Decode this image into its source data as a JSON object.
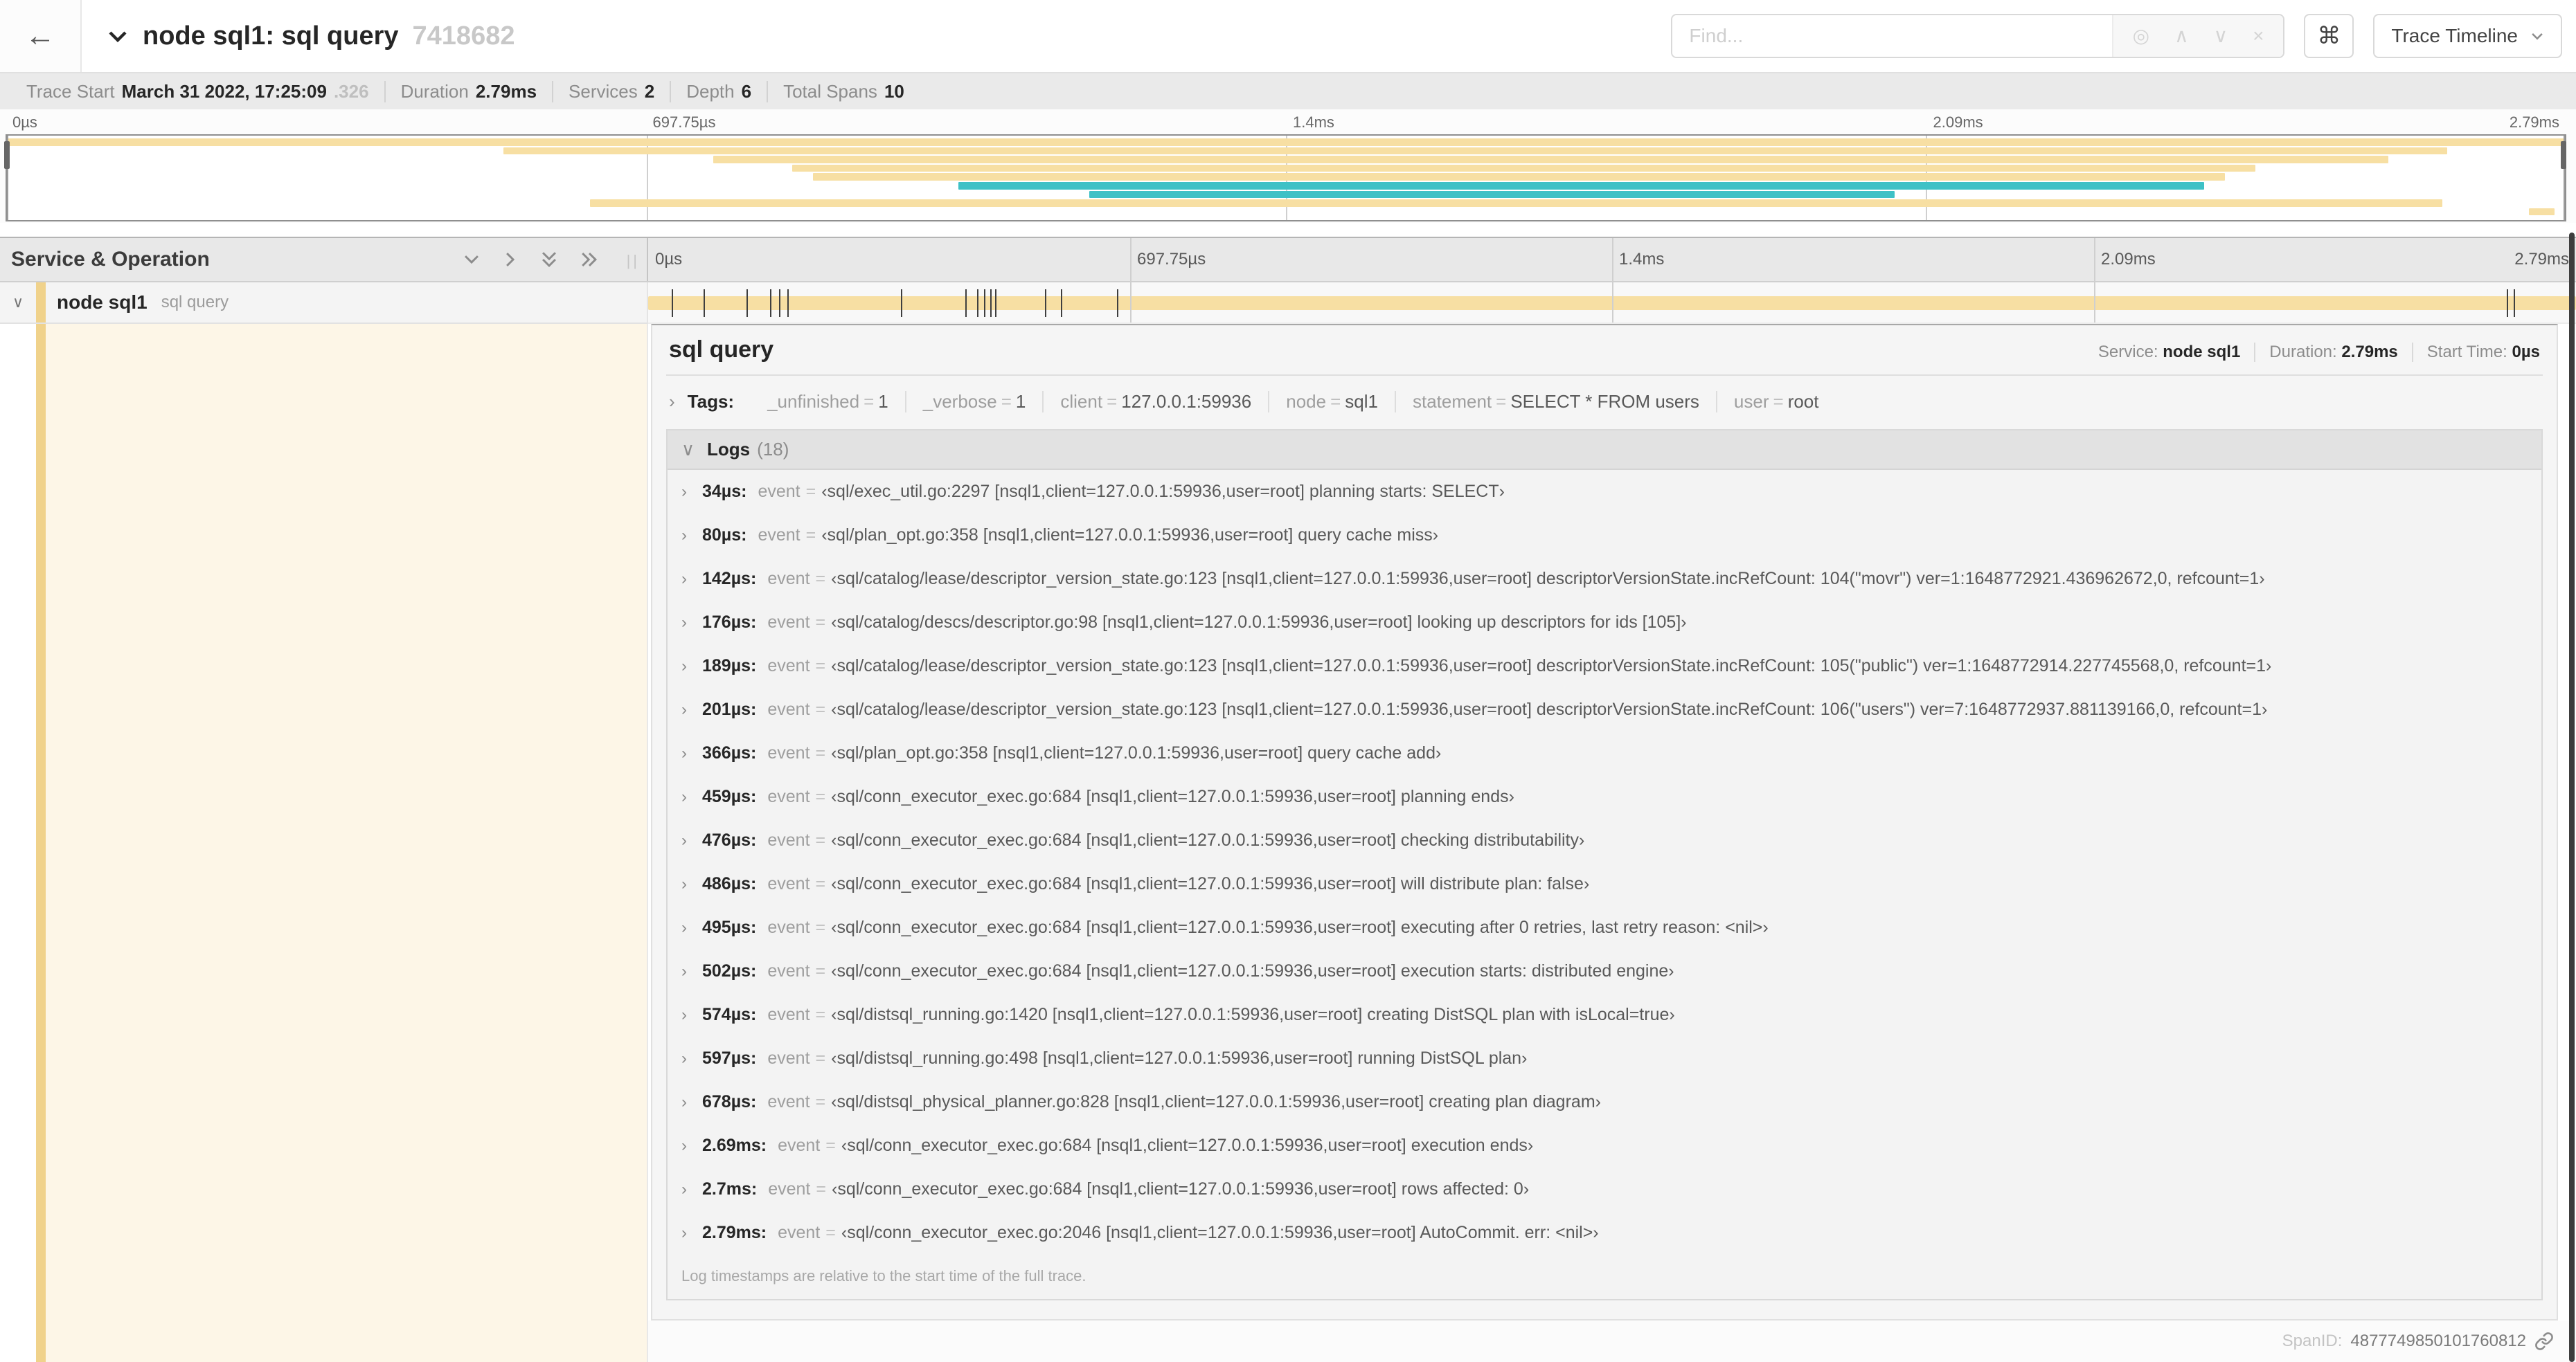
{
  "colors": {
    "tan": "#F7DFA3",
    "teal": "#3EC1C6",
    "strip": "#F0D28B",
    "cream": "#FDF6E7"
  },
  "icons": {
    "back": "←",
    "chevron_down": "∨",
    "chevron_right": "›",
    "focus": "◎",
    "up": "∧",
    "down": "∨",
    "close": "×",
    "command": "⌘",
    "grip": "||"
  },
  "header": {
    "title": "node sql1: sql query",
    "trace_id": "7418682",
    "find_placeholder": "Find...",
    "view_select_label": "Trace Timeline"
  },
  "trace_info": {
    "items": [
      {
        "label": "Trace Start",
        "value": "March 31 2022, 17:25:09",
        "suffix": ".326"
      },
      {
        "label": "Duration",
        "value": "2.79ms"
      },
      {
        "label": "Services",
        "value": "2"
      },
      {
        "label": "Depth",
        "value": "6"
      },
      {
        "label": "Total Spans",
        "value": "10"
      }
    ]
  },
  "minimap": {
    "ticks": [
      "0µs",
      "697.75µs",
      "1.4ms",
      "2.09ms",
      "2.79ms"
    ],
    "spans": [
      {
        "start": 0.0,
        "end": 1.0,
        "color": "tan"
      },
      {
        "start": 0.194,
        "end": 0.954,
        "color": "tan"
      },
      {
        "start": 0.276,
        "end": 0.931,
        "color": "tan"
      },
      {
        "start": 0.307,
        "end": 0.879,
        "color": "tan"
      },
      {
        "start": 0.315,
        "end": 0.867,
        "color": "tan"
      },
      {
        "start": 0.372,
        "end": 0.859,
        "color": "teal"
      },
      {
        "start": 0.423,
        "end": 0.738,
        "color": "teal"
      },
      {
        "start": 0.228,
        "end": 0.952,
        "color": "tan"
      },
      {
        "start": 0.986,
        "end": 0.996,
        "color": "tan"
      }
    ]
  },
  "timeline": {
    "column_header": "Service & Operation",
    "ticks": [
      "0µs",
      "697.75µs",
      "1.4ms",
      "2.09ms",
      "2.79ms"
    ]
  },
  "span_row": {
    "service": "node sql1",
    "operation": "sql query",
    "duration_us": 2790,
    "log_marker_times_us": [
      34,
      80,
      142,
      176,
      189,
      201,
      366,
      459,
      476,
      486,
      495,
      502,
      574,
      597,
      678,
      2690,
      2700,
      2790
    ]
  },
  "detail": {
    "title": "sql query",
    "meta": [
      {
        "label": "Service:",
        "value": "node sql1"
      },
      {
        "label": "Duration:",
        "value": "2.79ms"
      },
      {
        "label": "Start Time:",
        "value": "0µs"
      }
    ],
    "tags": {
      "label": "Tags:",
      "eq": "=",
      "items": [
        {
          "key": "_unfinished",
          "value": "1"
        },
        {
          "key": "_verbose",
          "value": "1"
        },
        {
          "key": "client",
          "value": "127.0.0.1:59936"
        },
        {
          "key": "node",
          "value": "sql1"
        },
        {
          "key": "statement",
          "value": "SELECT * FROM users"
        },
        {
          "key": "user",
          "value": "root"
        }
      ]
    },
    "logs": {
      "label": "Logs",
      "count": "(18)",
      "field": "event",
      "eq": "=",
      "entries": [
        {
          "time": "34µs:",
          "message": "‹sql/exec_util.go:2297 [nsql1,client=127.0.0.1:59936,user=root] planning starts: SELECT›"
        },
        {
          "time": "80µs:",
          "message": "‹sql/plan_opt.go:358 [nsql1,client=127.0.0.1:59936,user=root] query cache miss›"
        },
        {
          "time": "142µs:",
          "message": "‹sql/catalog/lease/descriptor_version_state.go:123 [nsql1,client=127.0.0.1:59936,user=root] descriptorVersionState.incRefCount: 104(\"movr\") ver=1:1648772921.436962672,0, refcount=1›"
        },
        {
          "time": "176µs:",
          "message": "‹sql/catalog/descs/descriptor.go:98 [nsql1,client=127.0.0.1:59936,user=root] looking up descriptors for ids [105]›"
        },
        {
          "time": "189µs:",
          "message": "‹sql/catalog/lease/descriptor_version_state.go:123 [nsql1,client=127.0.0.1:59936,user=root] descriptorVersionState.incRefCount: 105(\"public\") ver=1:1648772914.227745568,0, refcount=1›"
        },
        {
          "time": "201µs:",
          "message": "‹sql/catalog/lease/descriptor_version_state.go:123 [nsql1,client=127.0.0.1:59936,user=root] descriptorVersionState.incRefCount: 106(\"users\") ver=7:1648772937.881139166,0, refcount=1›"
        },
        {
          "time": "366µs:",
          "message": "‹sql/plan_opt.go:358 [nsql1,client=127.0.0.1:59936,user=root] query cache add›"
        },
        {
          "time": "459µs:",
          "message": "‹sql/conn_executor_exec.go:684 [nsql1,client=127.0.0.1:59936,user=root] planning ends›"
        },
        {
          "time": "476µs:",
          "message": "‹sql/conn_executor_exec.go:684 [nsql1,client=127.0.0.1:59936,user=root] checking distributability›"
        },
        {
          "time": "486µs:",
          "message": "‹sql/conn_executor_exec.go:684 [nsql1,client=127.0.0.1:59936,user=root] will distribute plan: false›"
        },
        {
          "time": "495µs:",
          "message": "‹sql/conn_executor_exec.go:684 [nsql1,client=127.0.0.1:59936,user=root] executing after 0 retries, last retry reason: <nil>›"
        },
        {
          "time": "502µs:",
          "message": "‹sql/conn_executor_exec.go:684 [nsql1,client=127.0.0.1:59936,user=root] execution starts: distributed engine›"
        },
        {
          "time": "574µs:",
          "message": "‹sql/distsql_running.go:1420 [nsql1,client=127.0.0.1:59936,user=root] creating DistSQL plan with isLocal=true›"
        },
        {
          "time": "597µs:",
          "message": "‹sql/distsql_running.go:498 [nsql1,client=127.0.0.1:59936,user=root] running DistSQL plan›"
        },
        {
          "time": "678µs:",
          "message": "‹sql/distsql_physical_planner.go:828 [nsql1,client=127.0.0.1:59936,user=root] creating plan diagram›"
        },
        {
          "time": "2.69ms:",
          "message": "‹sql/conn_executor_exec.go:684 [nsql1,client=127.0.0.1:59936,user=root] execution ends›"
        },
        {
          "time": "2.7ms:",
          "message": "‹sql/conn_executor_exec.go:684 [nsql1,client=127.0.0.1:59936,user=root] rows affected: 0›"
        },
        {
          "time": "2.79ms:",
          "message": "‹sql/conn_executor_exec.go:2046 [nsql1,client=127.0.0.1:59936,user=root] AutoCommit. err: <nil>›"
        }
      ],
      "note": "Log timestamps are relative to the start time of the full trace."
    },
    "footer": {
      "label": "SpanID:",
      "value": "4877749850101760812"
    }
  }
}
